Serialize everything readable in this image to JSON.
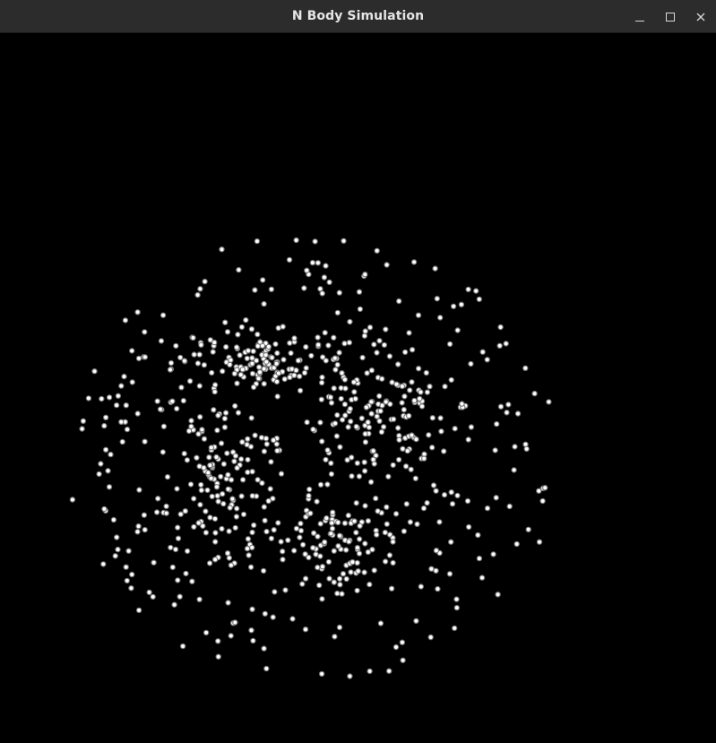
{
  "window": {
    "title": "N Body Simulation",
    "controls": {
      "minimize_icon": "minimize-icon",
      "maximize_icon": "maximize-icon",
      "close_icon": "close-icon"
    }
  },
  "simulation": {
    "background_color": "#000000",
    "body_fill": "#ffffff",
    "body_stroke": "#777777"
  }
}
